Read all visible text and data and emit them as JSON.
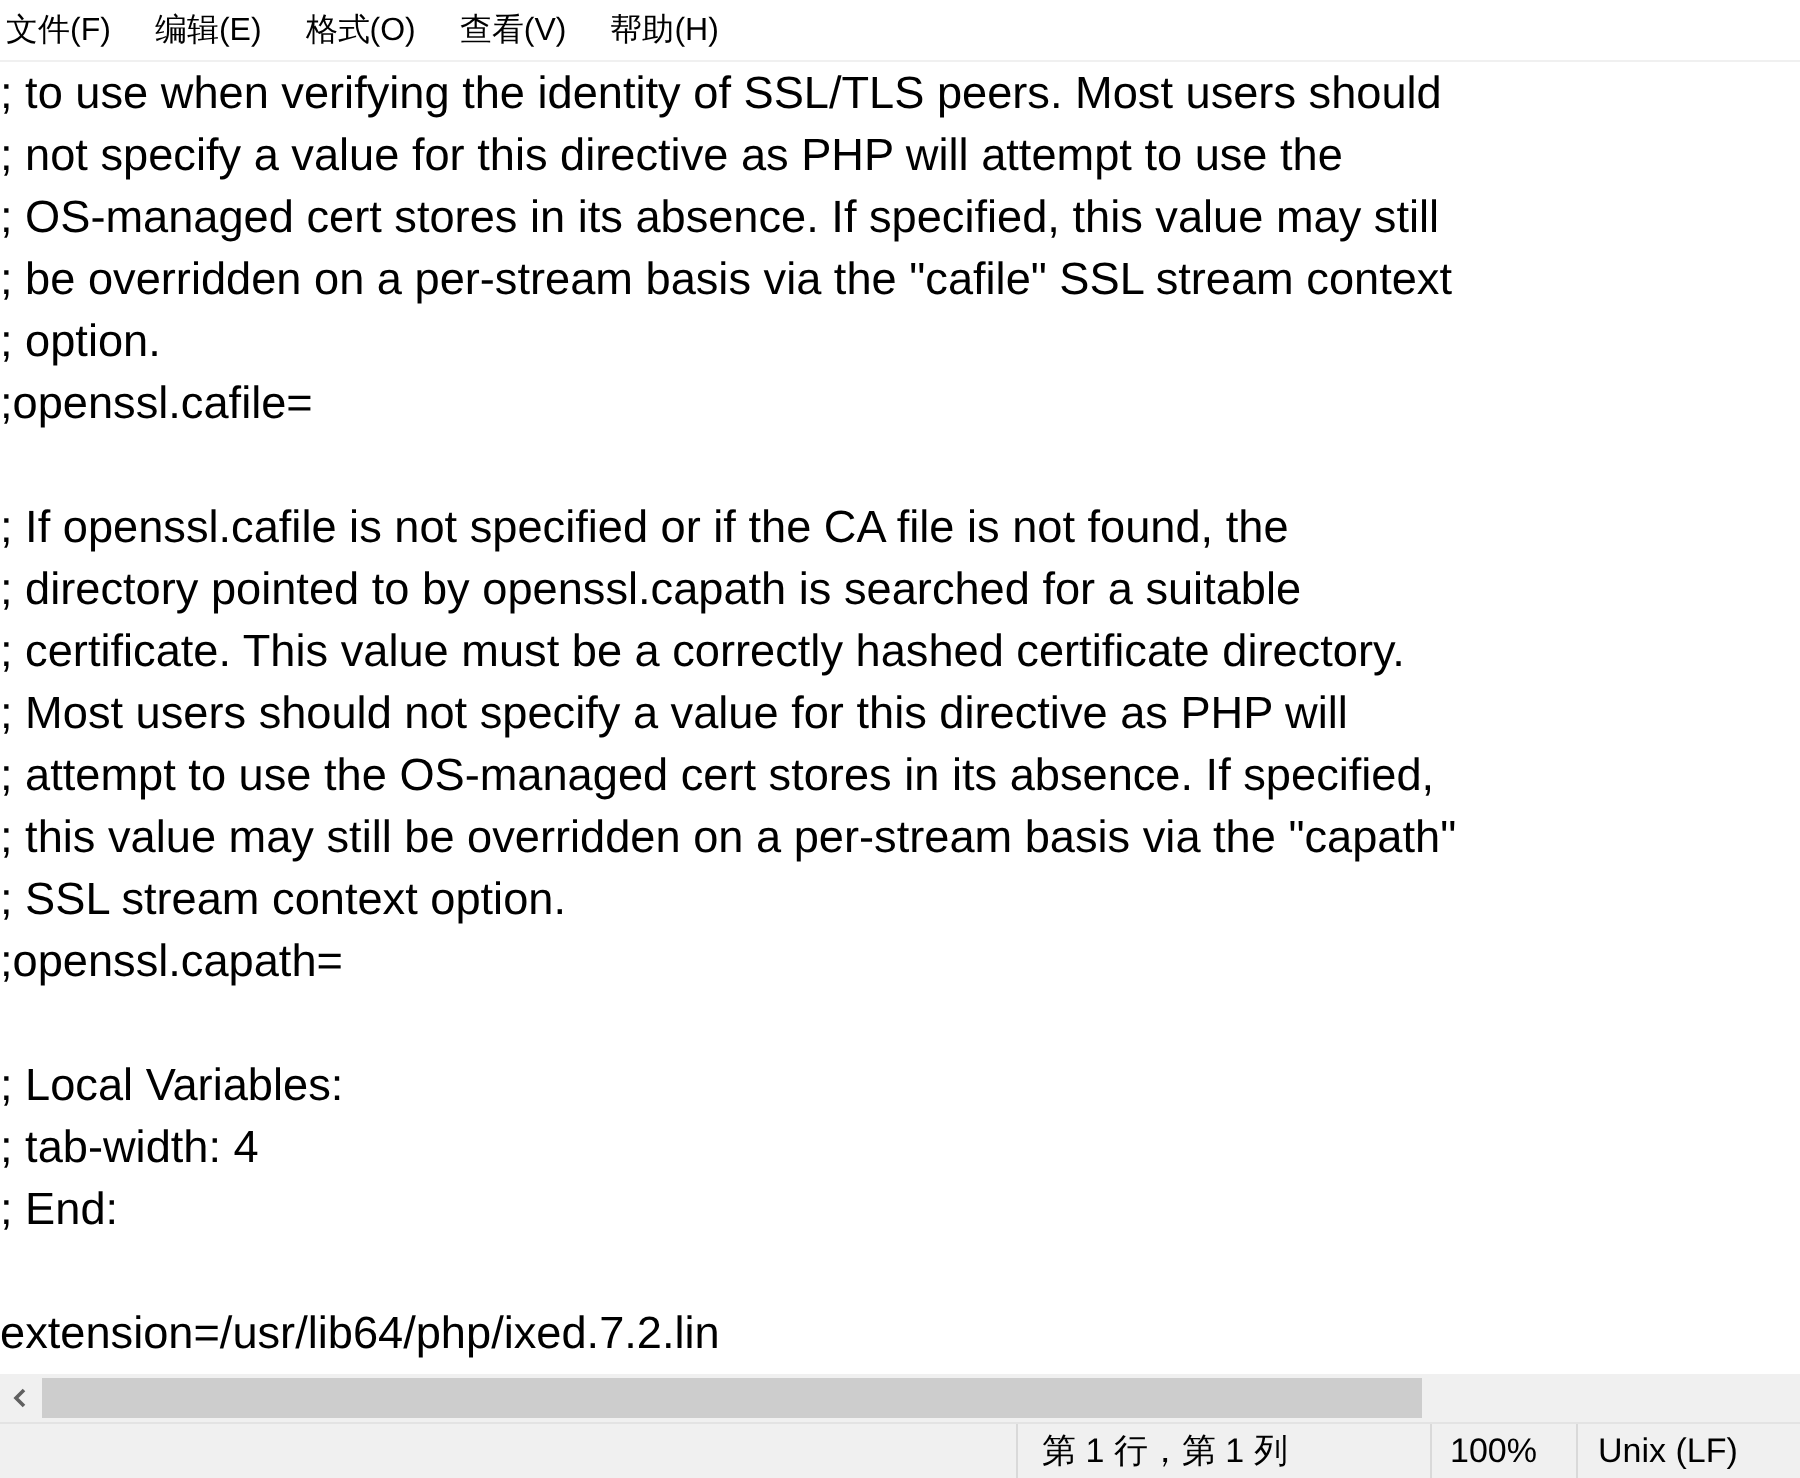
{
  "menu": [
    "文件(F)",
    "编辑(E)",
    "格式(O)",
    "查看(V)",
    "帮助(H)"
  ],
  "editor": {
    "blocks": [
      [
        "; to use when verifying the identity of SSL/TLS peers. Most users should",
        "; not specify a value for this directive as PHP will attempt to use the",
        "; OS-managed cert stores in its absence. If specified, this value may still",
        "; be overridden on a per-stream basis via the \"cafile\" SSL stream context",
        "; option.",
        ";openssl.cafile="
      ],
      [
        "; If openssl.cafile is not specified or if the CA file is not found, the",
        "; directory pointed to by openssl.capath is searched for a suitable",
        "; certificate. This value must be a correctly hashed certificate directory.",
        "; Most users should not specify a value for this directive as PHP will",
        "; attempt to use the OS-managed cert stores in its absence. If specified,",
        "; this value may still be overridden on a per-stream basis via the \"capath\"",
        "; SSL stream context option.",
        ";openssl.capath="
      ],
      [
        "; Local Variables:",
        "; tab-width: 4",
        "; End:"
      ],
      [
        "extension=/usr/lib64/php/ixed.7.2.lin"
      ]
    ]
  },
  "status_bar": {
    "position": "第 1 行，第 1 列",
    "zoom": "100%",
    "line_ending": "Unix (LF)"
  }
}
